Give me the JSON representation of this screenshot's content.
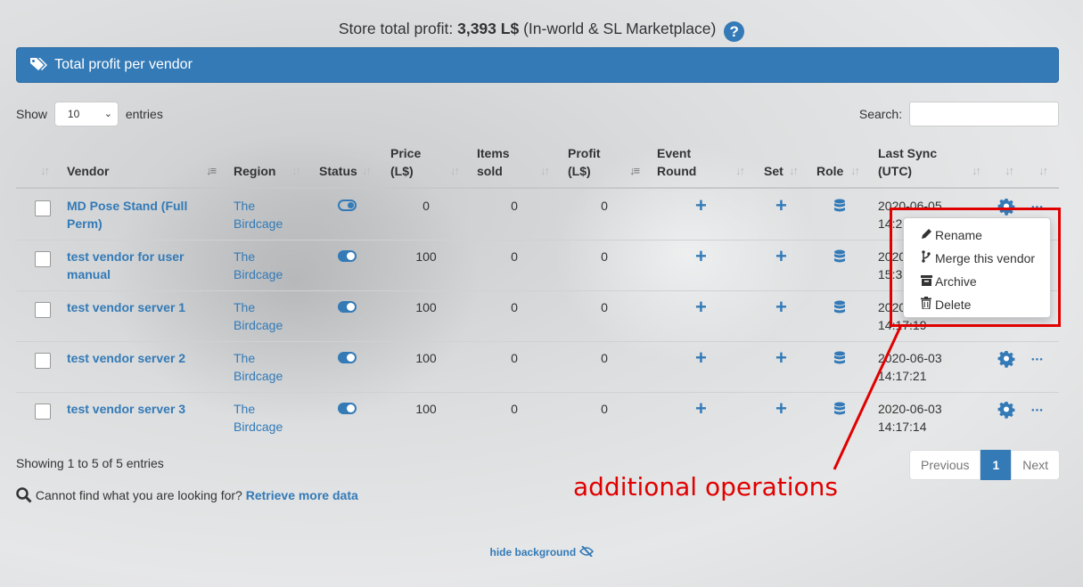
{
  "header": {
    "profit_label": "Store total profit:",
    "profit_value": "3,393 L$",
    "profit_suffix": "(In-world & SL Marketplace)",
    "help_icon": "question-circle-icon"
  },
  "panel": {
    "title": "Total profit per vendor",
    "icon": "tags-icon"
  },
  "length_menu": {
    "show": "Show",
    "value": "10",
    "entries": "entries"
  },
  "search": {
    "label": "Search:",
    "value": ""
  },
  "columns": [
    {
      "key": "vendor",
      "label": "Vendor"
    },
    {
      "key": "region",
      "label": "Region"
    },
    {
      "key": "status",
      "label": "Status"
    },
    {
      "key": "price",
      "label": "Price",
      "label2": "(L$)"
    },
    {
      "key": "items_sold",
      "label": "Items",
      "label2": "sold"
    },
    {
      "key": "profit",
      "label": "Profit",
      "label2": "(L$)"
    },
    {
      "key": "event_round",
      "label": "Event",
      "label2": "Round"
    },
    {
      "key": "set",
      "label": "Set"
    },
    {
      "key": "role",
      "label": "Role"
    },
    {
      "key": "last_sync",
      "label": "Last Sync",
      "label2": "(UTC)"
    }
  ],
  "rows": [
    {
      "vendor": "MD Pose Stand (Full Perm)",
      "region": "The Birdcage",
      "status": "off",
      "price": "0",
      "items_sold": "0",
      "profit": "0",
      "sync_date": "2020-06-05",
      "sync_time": "14:2"
    },
    {
      "vendor": "test vendor for user manual",
      "region": "The Birdcage",
      "status": "on",
      "price": "100",
      "items_sold": "0",
      "profit": "0",
      "sync_date": "2020-",
      "sync_time": "15:3"
    },
    {
      "vendor": "test vendor server 1",
      "region": "The Birdcage",
      "status": "on",
      "price": "100",
      "items_sold": "0",
      "profit": "0",
      "sync_date": "2020-",
      "sync_time": "14:17:19"
    },
    {
      "vendor": "test vendor server 2",
      "region": "The Birdcage",
      "status": "on",
      "price": "100",
      "items_sold": "0",
      "profit": "0",
      "sync_date": "2020-06-03",
      "sync_time": "14:17:21"
    },
    {
      "vendor": "test vendor server 3",
      "region": "The Birdcage",
      "status": "on",
      "price": "100",
      "items_sold": "0",
      "profit": "0",
      "sync_date": "2020-06-03",
      "sync_time": "14:17:14"
    }
  ],
  "row_icons": {
    "add": "plus-icon",
    "role": "database-icon",
    "settings": "gear-icon",
    "more": "ellipsis-icon"
  },
  "context_menu": [
    {
      "label": "Rename",
      "icon": "pencil-icon"
    },
    {
      "label": "Merge this vendor",
      "icon": "code-fork-icon"
    },
    {
      "label": "Archive",
      "icon": "archive-icon"
    },
    {
      "label": "Delete",
      "icon": "trash-icon"
    }
  ],
  "footer": {
    "info": "Showing 1 to 5 of 5 entries",
    "previous": "Previous",
    "page": "1",
    "next": "Next",
    "cannot_find": "Cannot find what you are looking for?",
    "retrieve": "Retrieve more data",
    "hide_background": "hide background"
  },
  "annotation": {
    "text": "additional operations",
    "color": "#e00000"
  },
  "colors": {
    "accent": "#337ab7",
    "annotation": "#e00000"
  }
}
